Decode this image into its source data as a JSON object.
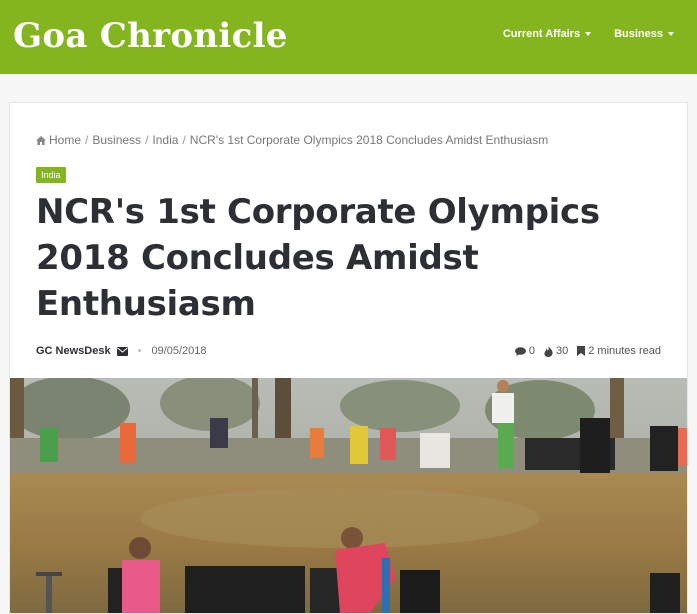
{
  "site": {
    "title": "Goa Chronicle"
  },
  "nav": {
    "items": [
      {
        "label": "Current Affairs"
      },
      {
        "label": "Business"
      }
    ]
  },
  "breadcrumb": {
    "home": "Home",
    "items": [
      "Business",
      "India",
      "NCR's 1st Corporate Olympics 2018 Concludes Amidst Enthusiasm"
    ],
    "separator": "/"
  },
  "article": {
    "category": "India",
    "headline": "NCR's 1st Corporate Olympics 2018 Concludes Amidst Enthusiasm",
    "author": "GC NewsDesk",
    "date": "09/05/2018",
    "comments": "0",
    "views": "30",
    "read_time": "2 minutes read"
  },
  "colors": {
    "brand": "#84b51e",
    "text": "#2c2f34"
  },
  "icons": [
    "home-icon",
    "caret-down-icon",
    "envelope-icon",
    "comment-icon",
    "fire-icon",
    "bookmark-icon"
  ]
}
